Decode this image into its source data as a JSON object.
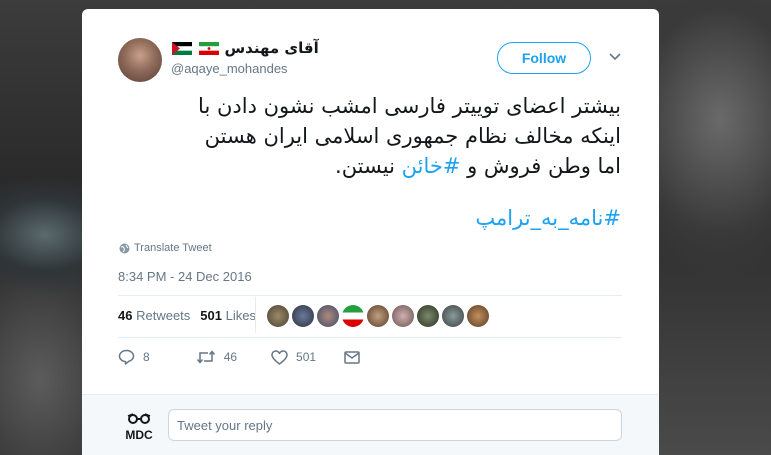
{
  "author": {
    "name": "آقای مهندس",
    "handle": "@aqaye_mohandes"
  },
  "follow_label": "Follow",
  "tweet": {
    "lines": [
      "بیشتر اعضای توییتر فارسی امشب نشون دادن با",
      "اینکه مخالف نظام جمهوری اسلامی ایران هستن"
    ],
    "line3_before": "اما وطن فروش و ",
    "line3_hashtag": "#خائن",
    "line3_after": " نیستن.",
    "hashtag2": "#نامه_به_ترامپ"
  },
  "translate_label": "Translate Tweet",
  "timestamp": "8:34 PM - 24 Dec 2016",
  "stats": {
    "retweets_count": "46",
    "retweets_label": "Retweets",
    "likes_count": "501",
    "likes_label": "Likes"
  },
  "actions": {
    "reply_count": "8",
    "retweet_count": "46",
    "like_count": "501"
  },
  "reply": {
    "logo_text": "MDC",
    "placeholder": "Tweet your reply"
  },
  "colors": {
    "accent": "#1da1f2",
    "text": "#14171a",
    "muted": "#657786"
  },
  "icons": [
    "iran-flag-icon",
    "palestine-flag-icon",
    "chevron-down-icon",
    "globe-icon",
    "reply-icon",
    "retweet-icon",
    "heart-icon",
    "envelope-icon"
  ]
}
